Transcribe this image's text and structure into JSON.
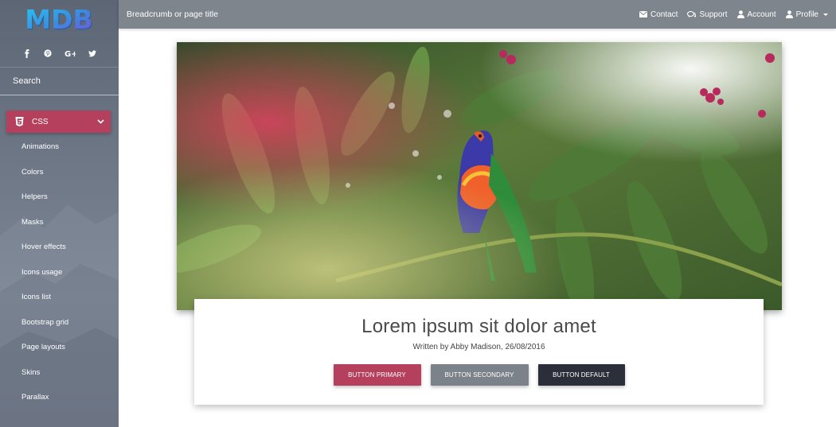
{
  "colors": {
    "accent": "#b5405e",
    "navbar": "#7f858c",
    "secondary": "#7c8289",
    "default": "#2b2f3a"
  },
  "sidebar": {
    "logo": "MDB",
    "social_icons": [
      "facebook-icon",
      "pinterest-icon",
      "google-plus-icon",
      "twitter-icon"
    ],
    "search_placeholder": "Search",
    "css_section": {
      "label": "CSS",
      "icon": "css3-icon",
      "expanded": true
    },
    "items": [
      {
        "label": "Animations"
      },
      {
        "label": "Colors"
      },
      {
        "label": "Helpers"
      },
      {
        "label": "Masks"
      },
      {
        "label": "Hover effects"
      },
      {
        "label": "Icons usage"
      },
      {
        "label": "Icons list"
      },
      {
        "label": "Bootstrap grid"
      },
      {
        "label": "Page layouts"
      },
      {
        "label": "Skins"
      },
      {
        "label": "Parallax"
      }
    ]
  },
  "navbar": {
    "breadcrumb": "Breadcrumb or page title",
    "links": {
      "contact": "Contact",
      "support": "Support",
      "account": "Account",
      "profile": "Profile"
    }
  },
  "card": {
    "title": "Lorem ipsum sit dolor amet",
    "subtitle": "Written by Abby Madison, 26/08/2016",
    "buttons": {
      "primary": "BUTTON PRIMARY",
      "secondary": "BUTTON SECONDARY",
      "default": "BUTTON DEFAULT"
    }
  }
}
